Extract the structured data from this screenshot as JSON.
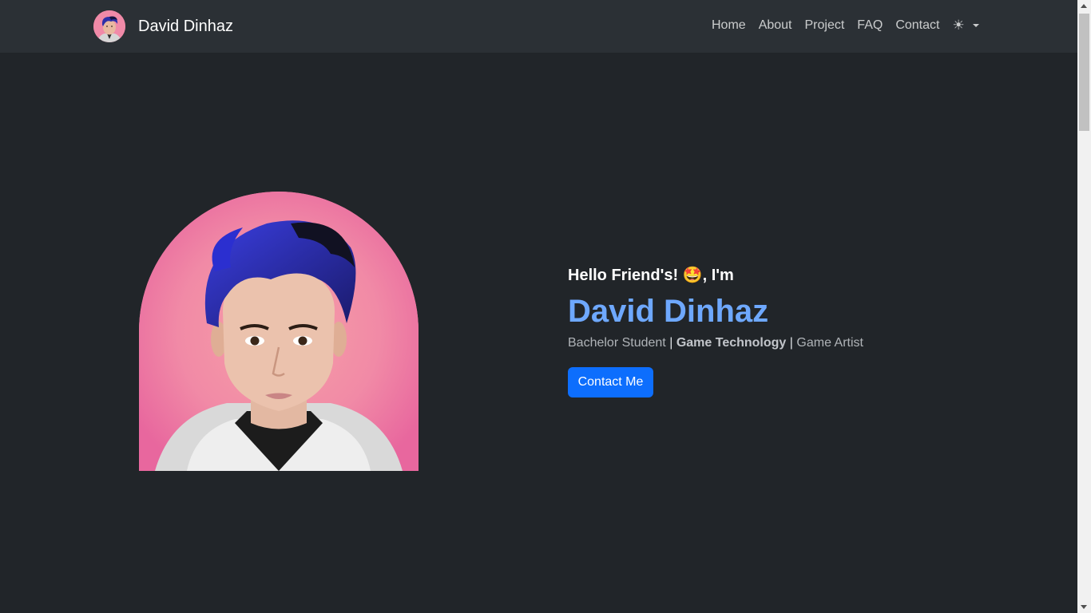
{
  "navbar": {
    "brand_name": "David Dinhaz",
    "links": [
      {
        "label": "Home"
      },
      {
        "label": "About"
      },
      {
        "label": "Project"
      },
      {
        "label": "FAQ"
      },
      {
        "label": "Contact"
      }
    ],
    "theme_icon": "sun-icon"
  },
  "hero": {
    "greeting_prefix": "Hello Friend's! ",
    "greeting_emoji": "🤩",
    "greeting_suffix": ", I'm",
    "name": "David Dinhaz",
    "roles": {
      "role1": "Bachelor Student",
      "role2": "Game Technology",
      "role3": "Game Artist",
      "separator": "|"
    },
    "cta_label": "Contact Me"
  },
  "colors": {
    "background": "#212529",
    "navbar": "#2b3035",
    "accent_name": "#6ea8fe",
    "button": "#0d6efd",
    "portrait_bg": "#ef86a8"
  }
}
